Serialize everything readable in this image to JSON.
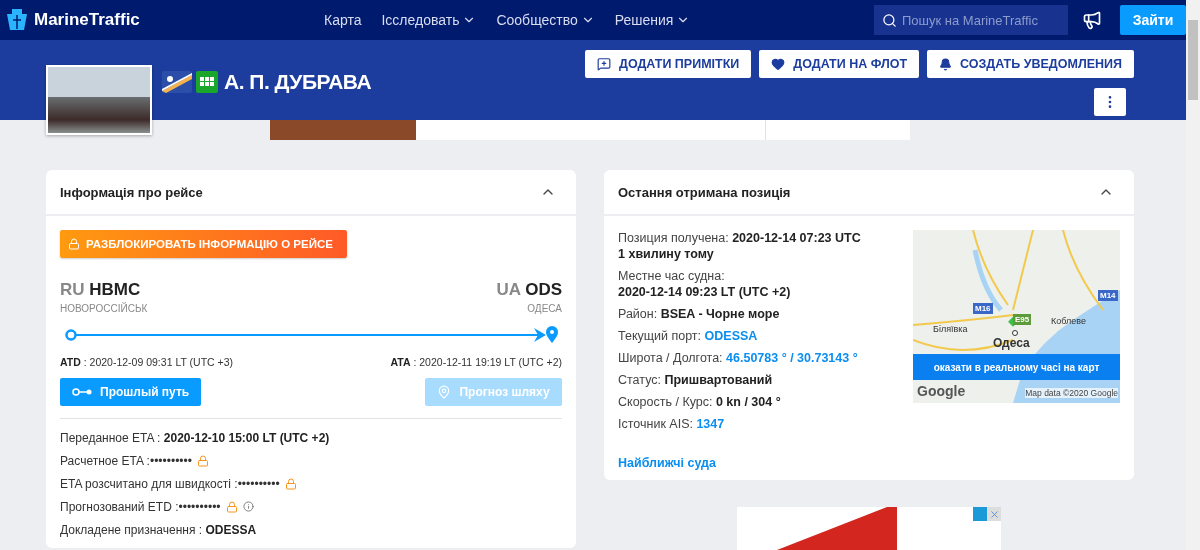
{
  "nav": {
    "logo": "MarineTraffic",
    "links": [
      {
        "label": "Карта",
        "dropdown": false
      },
      {
        "label": "Ісследовать",
        "dropdown": true
      },
      {
        "label": "Сообщество",
        "dropdown": true
      },
      {
        "label": "Решения",
        "dropdown": true
      }
    ],
    "search": {
      "placeholder": "Пошук на MarineTraffic"
    },
    "login": "Зайти"
  },
  "vessel": {
    "name": "А. П. ДУБРАВА",
    "actions": [
      {
        "label": "ДОДАТИ ПРИМІТКИ",
        "kind": "note"
      },
      {
        "label": "ДОДАТИ НА ФЛОТ",
        "kind": "heart"
      },
      {
        "label": "СОЗДАТЬ УВЕДОМЛЕНИЯ",
        "kind": "bell"
      }
    ]
  },
  "voyage": {
    "title": "Інформація про рейсе",
    "expanded": true,
    "unlock": "РАЗБЛОКИРОВАТЬ ІНФОРМАЦІЮ О РЕЙСЕ",
    "origin": {
      "country": "RU",
      "code": "НВМС",
      "city": "НОВОРОССІЙСЬК"
    },
    "destination": {
      "country": "UA",
      "code": "ODS",
      "city": "ОДЕСА"
    },
    "atd": {
      "label": "ATD",
      "value": " : 2020-12-09 09:31 LT (UTC +3)"
    },
    "ata": {
      "label": "ATA",
      "value": " : 2020-12-11 19:19 LT (UTC +2)"
    },
    "buttons": [
      {
        "label": "Прошлый путь",
        "kind": "past",
        "disabled": false
      },
      {
        "label": "Прогноз шляху",
        "kind": "forecast",
        "disabled": true
      }
    ],
    "details": [
      {
        "label": "Переданное ETA : ",
        "value": "2020-12-10 15:00 LT (UTC +2)",
        "locked": false,
        "info": false
      },
      {
        "label": "Расчетное ETA :",
        "value": "••••••••••",
        "locked": true,
        "info": false
      },
      {
        "label": "ETA розсчитано для швидкості :",
        "value": "••••••••••",
        "locked": true,
        "info": false
      },
      {
        "label": "Прогнозований ETD :",
        "value": "••••••••••",
        "locked": true,
        "info": true
      },
      {
        "label": "Докладене призначення : ",
        "value": "ODESSA",
        "locked": false,
        "info": false
      }
    ]
  },
  "position": {
    "title": "Остання отримана позиція",
    "expanded": true,
    "rows": [
      {
        "label": "Позиция получена: ",
        "value": "2020-12-14 07:23 UTC",
        "kind": "bold",
        "sub": "1 хвилину тому"
      },
      {
        "label": "Местне час судна:",
        "value": "2020-12-14 09:23 LT (UTC +2)",
        "kind": "bold-break"
      },
      {
        "label": "Район: ",
        "value": "BSEA - Чорне море",
        "kind": "bold"
      },
      {
        "label": "Текущий порт: ",
        "value": "ODESSA",
        "kind": "link"
      },
      {
        "label": "Широта / Долгота: ",
        "value": "46.50783 ° / 30.73143 °",
        "kind": "link"
      },
      {
        "label": "Статус: ",
        "value": "Пришвартований",
        "kind": "bold"
      },
      {
        "label": "Скорость / Курс: ",
        "value": "0 kn / 304 °",
        "kind": "bold"
      },
      {
        "label": "Істочник AIS: ",
        "value": "1347",
        "kind": "link"
      }
    ],
    "map": {
      "roads": [
        "M16",
        "E95",
        "M14"
      ],
      "places": [
        {
          "label": "Коблеве",
          "kind": "town"
        },
        {
          "label": "Біляївка",
          "kind": "town"
        },
        {
          "label": "Одеса",
          "kind": "city"
        }
      ],
      "button": "оказати в реальному часі на карт",
      "google": "Google",
      "attribution": "Map data ©2020 Google"
    },
    "nearby": "Найближчі суда"
  }
}
